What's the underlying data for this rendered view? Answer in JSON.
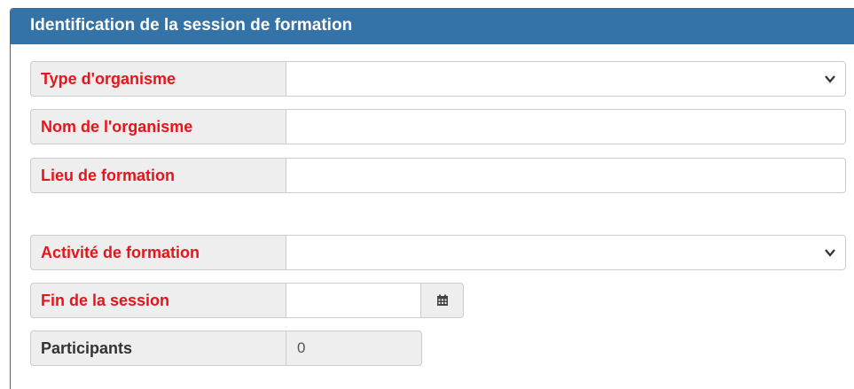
{
  "panel": {
    "title": "Identification de la session de formation"
  },
  "fields": {
    "type_organisme": {
      "label": "Type d'organisme",
      "value": ""
    },
    "nom_organisme": {
      "label": "Nom de l'organisme",
      "value": ""
    },
    "lieu_formation": {
      "label": "Lieu de formation",
      "value": ""
    },
    "activite_formation": {
      "label": "Activité de formation",
      "value": ""
    },
    "fin_session": {
      "label": "Fin de la session",
      "value": ""
    },
    "participants": {
      "label": "Participants",
      "value": "0"
    }
  },
  "icons": {
    "select_caret": "chevron-down-icon",
    "calendar": "calendar-icon"
  },
  "colors": {
    "header_bg": "#3473a8",
    "required_label": "#e8141b",
    "label_bg": "#eeeeee"
  }
}
